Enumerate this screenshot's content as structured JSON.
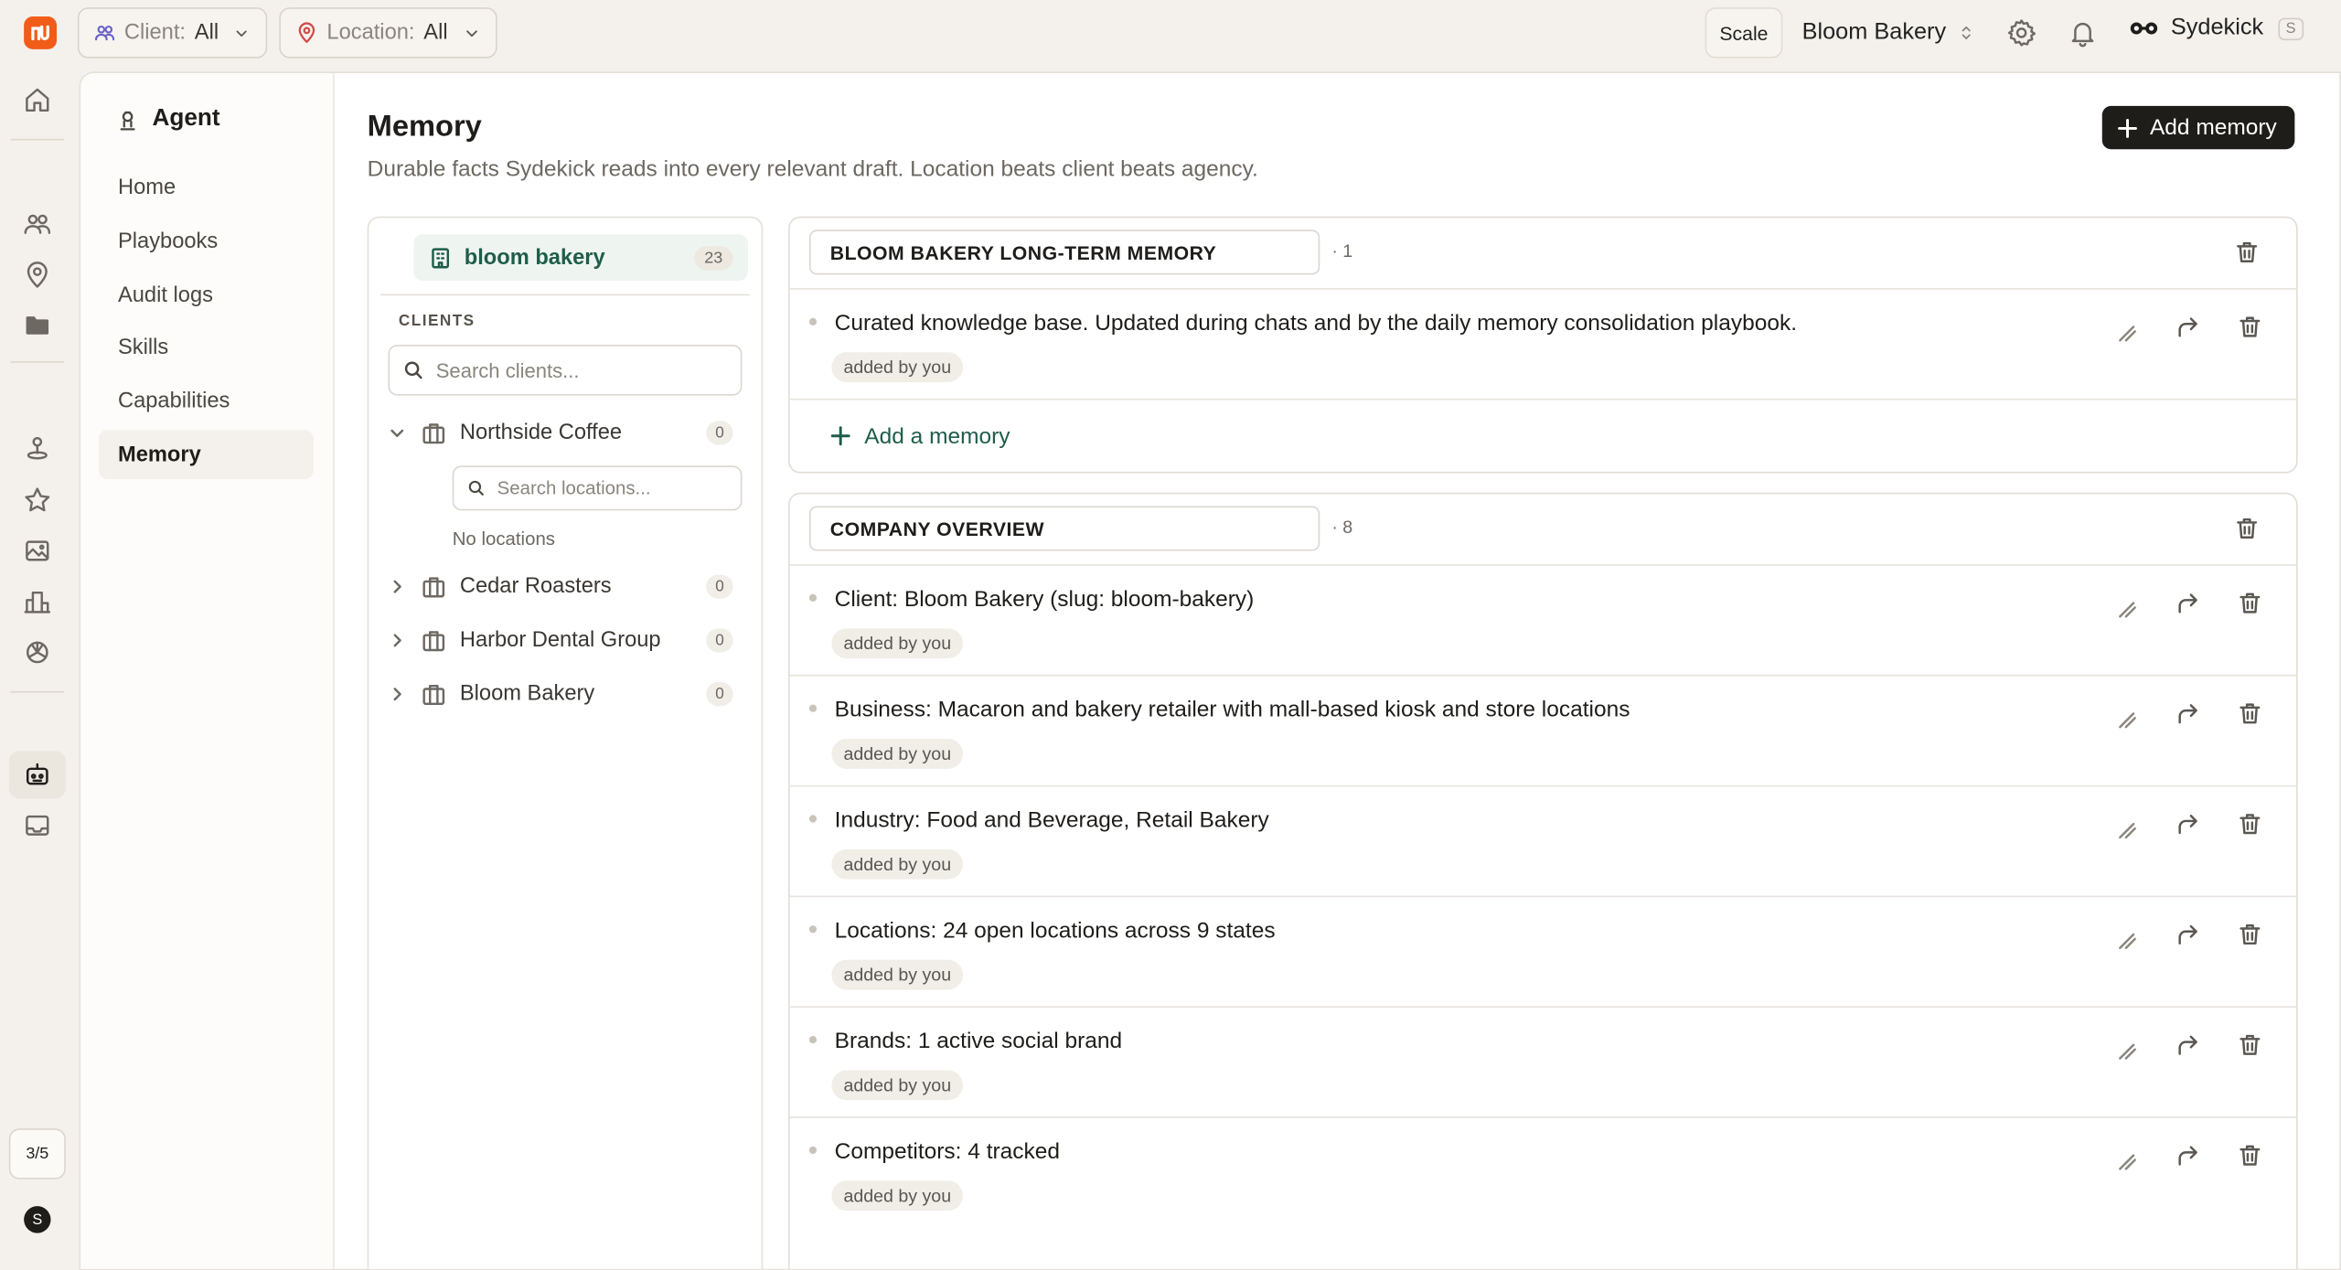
{
  "topbar": {
    "client_filter": {
      "label": "Client:",
      "value": "All"
    },
    "location_filter": {
      "label": "Location:",
      "value": "All"
    },
    "scale_label": "Scale",
    "brand_name": "Bloom Bakery",
    "agent_name": "Sydekick",
    "agent_shortcut": "S",
    "accent_color": "#f25c19"
  },
  "rail": {
    "pager": "3/5",
    "avatar": "S"
  },
  "subnav": {
    "title": "Agent",
    "items": [
      "Home",
      "Playbooks",
      "Audit logs",
      "Skills",
      "Capabilities",
      "Memory"
    ],
    "active": "Memory"
  },
  "page": {
    "title": "Memory",
    "subtitle": "Durable facts Sydekick reads into every relevant draft. Location beats client beats agency.",
    "add_button": "Add memory"
  },
  "tree": {
    "top": {
      "label": "bloom bakery",
      "count": "23"
    },
    "clients_label": "CLIENTS",
    "search_clients_placeholder": "Search clients...",
    "search_locations_placeholder": "Search locations...",
    "no_locations": "No locations",
    "clients": [
      {
        "name": "Northside Coffee",
        "count": "0",
        "expanded": true
      },
      {
        "name": "Cedar Roasters",
        "count": "0",
        "expanded": false
      },
      {
        "name": "Harbor Dental Group",
        "count": "0",
        "expanded": false
      },
      {
        "name": "Bloom Bakery",
        "count": "0",
        "expanded": false
      }
    ]
  },
  "sections": [
    {
      "name": "BLOOM BAKERY LONG-TERM MEMORY",
      "count": "· 1",
      "add_label": "Add a memory",
      "items": [
        {
          "text": "Curated knowledge base. Updated during chats and by the daily memory consolidation playbook.",
          "source": "added by you"
        }
      ]
    },
    {
      "name": "COMPANY OVERVIEW",
      "count": "· 8",
      "items": [
        {
          "text": "Client: Bloom Bakery (slug: bloom-bakery)",
          "source": "added by you"
        },
        {
          "text": "Business: Macaron and bakery retailer with mall-based kiosk and store locations",
          "source": "added by you"
        },
        {
          "text": "Industry: Food and Beverage, Retail Bakery",
          "source": "added by you"
        },
        {
          "text": "Locations: 24 open locations across 9 states",
          "source": "added by you"
        },
        {
          "text": "Brands: 1 active social brand",
          "source": "added by you"
        },
        {
          "text": "Competitors: 4 tracked",
          "source": "added by you"
        }
      ]
    }
  ]
}
